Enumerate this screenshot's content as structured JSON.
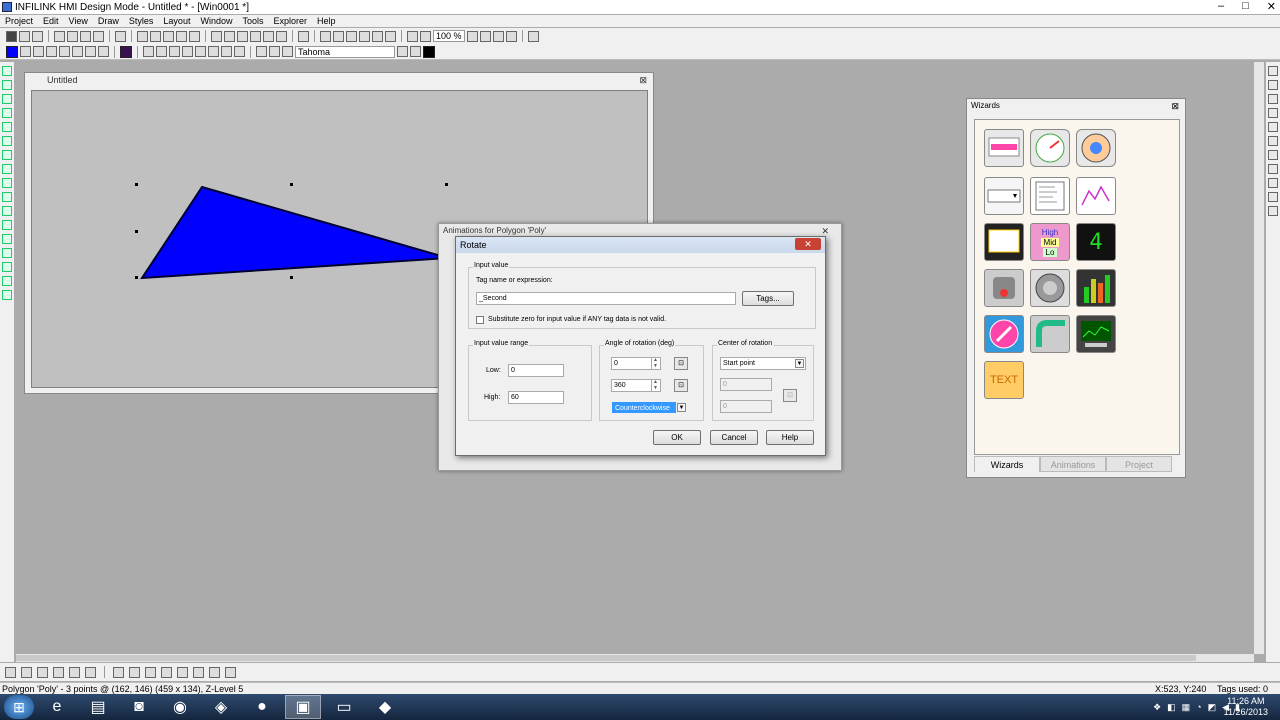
{
  "app": {
    "title": "INFILINK HMI Design Mode - Untitled * - [Win0001 *]",
    "win_controls": [
      "–",
      "□",
      "✕"
    ]
  },
  "menu": [
    "Project",
    "Edit",
    "View",
    "Draw",
    "Styles",
    "Layout",
    "Window",
    "Tools",
    "Explorer",
    "Help"
  ],
  "toolbar": {
    "zoom": "100 %",
    "font": "Tahoma"
  },
  "document": {
    "title": "Untitled",
    "close_glyph": "⊠"
  },
  "animations_dialog": {
    "title": "Animations for Polygon 'Poly'",
    "close_glyph": "✕"
  },
  "rotate": {
    "title": "Rotate",
    "close_glyph": "✕",
    "input_value_label": "Input value",
    "tag_expr_label": "Tag name or expression:",
    "tag_value": "_Second",
    "tags_button": "Tags...",
    "substitute_label": "Substitute zero for input value if ANY tag data is not valid.",
    "input_range_label": "Input value range",
    "low_label": "Low:",
    "low_value": "0",
    "high_label": "High:",
    "high_value": "60",
    "angle_label": "Angle of rotation (deg)",
    "angle_start": "0",
    "angle_end": "360",
    "direction": "Counterclockwise",
    "center_label": "Center of rotation",
    "center_value": "Start point",
    "center_x": "0",
    "center_y": "0",
    "ok": "OK",
    "cancel": "Cancel",
    "help": "Help"
  },
  "wizards": {
    "title": "Wizards",
    "close_glyph": "⊠",
    "high_label": "High",
    "mid_label": "Mid",
    "lo_label": "Lo",
    "digit": "4",
    "text_item": "TEXT",
    "tabs": [
      "Wizards",
      "Animations",
      "Project"
    ]
  },
  "status": {
    "left": "Polygon 'Poly' - 3 points @ (162, 146) (459 x 134), Z-Level 5",
    "coords": "X:523, Y:240",
    "tags": "Tags used: 0"
  },
  "clock": {
    "time": "11:26 AM",
    "date": "11/26/2013"
  },
  "colors": {
    "polygon_fill": "#0000ff",
    "polygon_stroke": "#000033",
    "selection": "#3399ff",
    "close_red": "#c84233"
  }
}
